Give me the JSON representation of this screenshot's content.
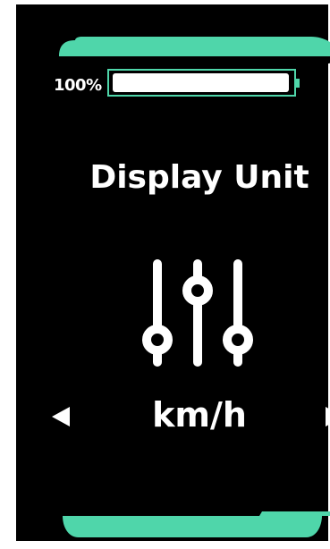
{
  "device": {
    "battery": {
      "label": "100%",
      "level": 1.0
    },
    "screen_title": "Display Unit",
    "selected_value": "km/h",
    "icon": "sliders-icon",
    "nav": {
      "prev_icon": "arrow-left-icon",
      "next_icon": "arrow-right-icon"
    }
  },
  "colors": {
    "accent": "#4fd6aa",
    "background": "#000000",
    "foreground": "#ffffff"
  }
}
